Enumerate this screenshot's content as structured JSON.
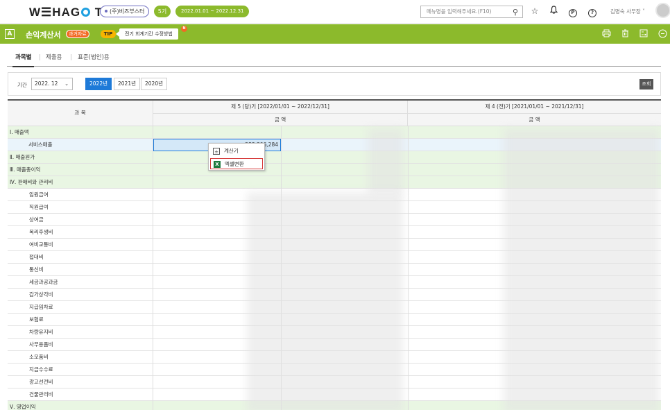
{
  "topbar": {
    "logo": "WEHAGO T",
    "company": "(주)비즈부스터",
    "term": "5기",
    "period": "2022.01.01 ~ 2022.12.31",
    "menu_search_placeholder": "메뉴명을 입력해주세요.(F10)",
    "user": "김명숙 사무장 ˅",
    "icons": [
      "search-icon",
      "star-icon",
      "bell-icon",
      "p-circle-icon",
      "help-icon"
    ]
  },
  "titlebar": {
    "home_letter": "A",
    "title": "손익계산서",
    "past_badge": "과거자료",
    "tip_badge": "TIP",
    "tip_text": "전기 회계기간 수정방법",
    "new_badge": "N",
    "icons": [
      "print-icon",
      "delete-icon",
      "calculator-icon",
      "more-icon"
    ]
  },
  "tabs": [
    "과목별",
    "제출용",
    "표준(법인)용"
  ],
  "filter": {
    "label": "기간",
    "period_value": "2022. 12",
    "years": [
      "2022년",
      "2021년",
      "2020년"
    ],
    "query_button": "조회"
  },
  "grid": {
    "col_subject": "과 목",
    "current_period": "제 5 (당)기  [2022/01/01 ~ 2022/12/31]",
    "prior_period": "제 4 (전)기  [2021/01/01 ~ 2021/12/31]",
    "amount_current": "금 액",
    "amount_prior": "금 액",
    "selected_value": "283,306,284",
    "rows": [
      {
        "label": "Ⅰ. 매출액",
        "type": "green"
      },
      {
        "label": "서비스매출",
        "type": "selected"
      },
      {
        "label": "Ⅱ. 매출원가",
        "type": "green"
      },
      {
        "label": "Ⅲ. 매출총이익",
        "type": "green"
      },
      {
        "label": "Ⅳ. 판매비와 관리비",
        "type": "green"
      },
      {
        "label": "임원급여",
        "type": "sub"
      },
      {
        "label": "직원급여",
        "type": "sub"
      },
      {
        "label": "상여금",
        "type": "sub"
      },
      {
        "label": "복리후생비",
        "type": "sub"
      },
      {
        "label": "여비교통비",
        "type": "sub"
      },
      {
        "label": "접대비",
        "type": "sub"
      },
      {
        "label": "통신비",
        "type": "sub"
      },
      {
        "label": "세금과공과금",
        "type": "sub"
      },
      {
        "label": "감가상각비",
        "type": "sub"
      },
      {
        "label": "지급임차료",
        "type": "sub"
      },
      {
        "label": "보험료",
        "type": "sub"
      },
      {
        "label": "차량유지비",
        "type": "sub"
      },
      {
        "label": "사무용품비",
        "type": "sub"
      },
      {
        "label": "소모품비",
        "type": "sub"
      },
      {
        "label": "지급수수료",
        "type": "sub"
      },
      {
        "label": "광고선전비",
        "type": "sub"
      },
      {
        "label": "건물관리비",
        "type": "sub"
      },
      {
        "label": "Ⅴ. 영업이익",
        "type": "green"
      }
    ]
  },
  "context_menu": {
    "items": [
      "계산기",
      "엑셀변환"
    ],
    "highlighted": "엑셀변환"
  }
}
